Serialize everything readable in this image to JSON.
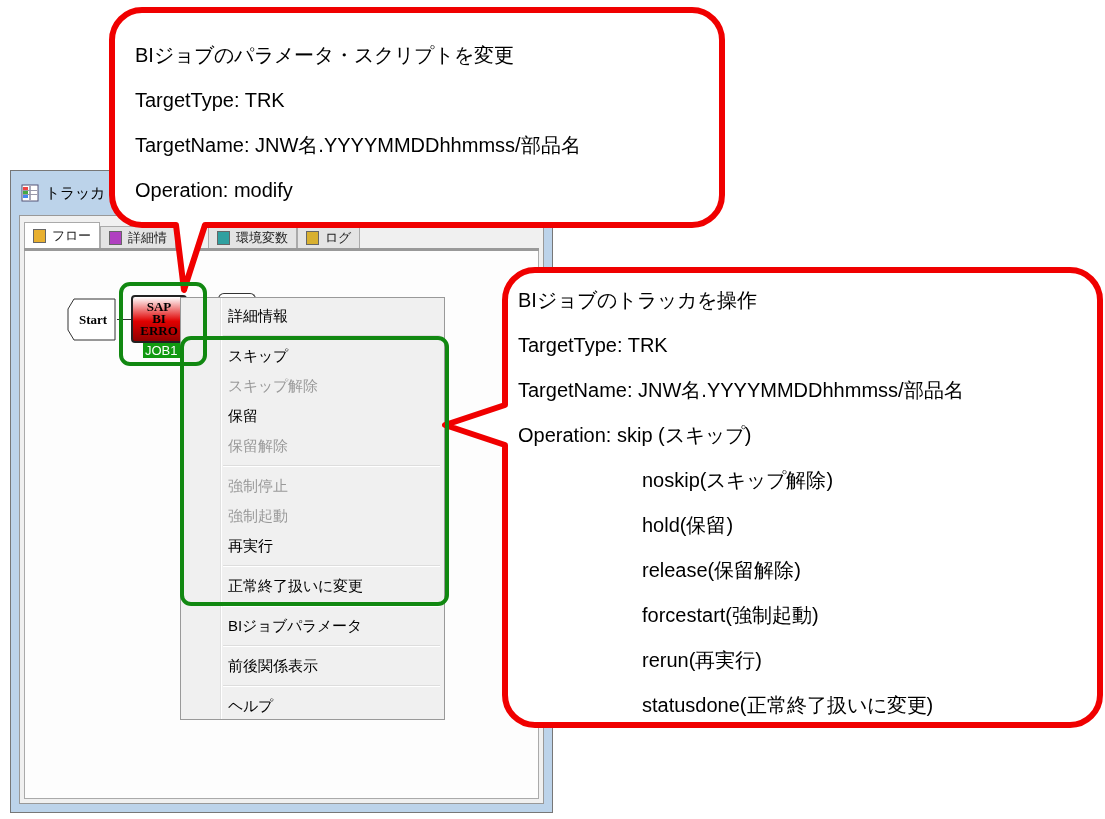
{
  "window": {
    "title": "トラッカ"
  },
  "tabs": [
    {
      "label": "フロー",
      "selected": true
    },
    {
      "label": "詳細情",
      "selected": false
    },
    {
      "label": "環境変数",
      "selected": false
    },
    {
      "label": "ログ",
      "selected": false
    }
  ],
  "flow": {
    "start": {
      "label": "Start"
    },
    "job": {
      "label": "JOB1",
      "icon_text": [
        "SAP",
        "BI",
        "ERRO"
      ],
      "selected": true
    }
  },
  "context_menu": {
    "groups": [
      [
        {
          "label": "詳細情報",
          "disabled": false
        }
      ],
      [
        {
          "label": "スキップ",
          "disabled": false
        },
        {
          "label": "スキップ解除",
          "disabled": true
        },
        {
          "label": "保留",
          "disabled": false
        },
        {
          "label": "保留解除",
          "disabled": true
        }
      ],
      [
        {
          "label": "強制停止",
          "disabled": true
        },
        {
          "label": "強制起動",
          "disabled": true
        },
        {
          "label": "再実行",
          "disabled": false
        }
      ],
      [
        {
          "label": "正常終了扱いに変更",
          "disabled": false
        }
      ],
      [
        {
          "label": "BIジョブパラメータ",
          "disabled": false
        }
      ],
      [
        {
          "label": "前後関係表示",
          "disabled": false
        }
      ],
      [
        {
          "label": "ヘルプ",
          "disabled": false
        }
      ]
    ]
  },
  "callouts": [
    {
      "lines": [
        "BIジョブのパラメータ・スクリプトを変更",
        "TargetType: TRK",
        "TargetName: JNW名.YYYYMMDDhhmmss/部品名",
        "Operation: modify"
      ]
    },
    {
      "lines": [
        "BIジョブのトラッカを操作",
        "TargetType: TRK",
        "TargetName: JNW名.YYYYMMDDhhmmss/部品名",
        "Operation: skip (スキップ)"
      ],
      "sub_lines": [
        "noskip(スキップ解除)",
        "hold(保留)",
        "release(保留解除)",
        "forcestart(強制起動)",
        "rerun(再実行)",
        "statusdone(正常終了扱いに変更)"
      ]
    }
  ]
}
